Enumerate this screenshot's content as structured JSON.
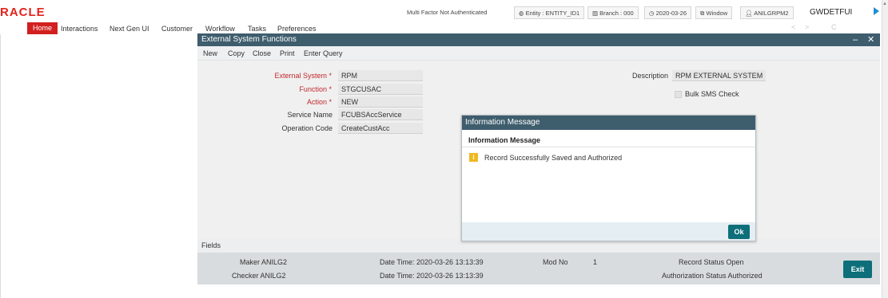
{
  "topbar": {
    "logo": "ORACLE",
    "logo_visible": "RACLE",
    "mfa": "Multi Factor Not Authenticated",
    "entity": "Entity : ENTITY_ID1",
    "branch": "Branch : 000",
    "date": "2020-03-26",
    "window": "Window",
    "user": "ANILGRPM2",
    "env": "GWDETFUI"
  },
  "menu": {
    "items": [
      "Home",
      "Interactions",
      "Next Gen UI",
      "Customer",
      "Workflow",
      "Tasks",
      "Preferences"
    ],
    "nav_controls": [
      "<",
      ">",
      "C"
    ]
  },
  "window": {
    "title": "External System Functions",
    "toolbar": [
      "New",
      "Copy",
      "Close",
      "Print",
      "Enter Query"
    ]
  },
  "form": {
    "external_system_label": "External System",
    "external_system_value": "RPM",
    "function_label": "Function",
    "function_value": "STGCUSAC",
    "action_label": "Action",
    "action_value": "NEW",
    "service_name_label": "Service Name",
    "service_name_value": "FCUBSAccService",
    "operation_code_label": "Operation Code",
    "operation_code_value": "CreateCustAcc",
    "description_label": "Description",
    "description_value": "RPM EXTERNAL SYSTEM",
    "bulk_sms_label": "Bulk SMS Check",
    "required_mark": "*"
  },
  "fields_label": "Fields",
  "audit": {
    "maker": "Maker ANILG2",
    "checker": "Checker ANILG2",
    "maker_datetime": "Date Time: 2020-03-26 13:13:39",
    "checker_datetime": "Date Time: 2020-03-26 13:13:39",
    "mod_no_label": "Mod No",
    "mod_no_value": "1",
    "record_status": "Record Status Open",
    "auth_status": "Authorization Status Authorized",
    "exit": "Exit"
  },
  "dialog": {
    "title": "Information Message",
    "heading": "Information Message",
    "icon_glyph": "i",
    "message": "Record Successfully Saved and Authorized",
    "ok": "Ok"
  }
}
